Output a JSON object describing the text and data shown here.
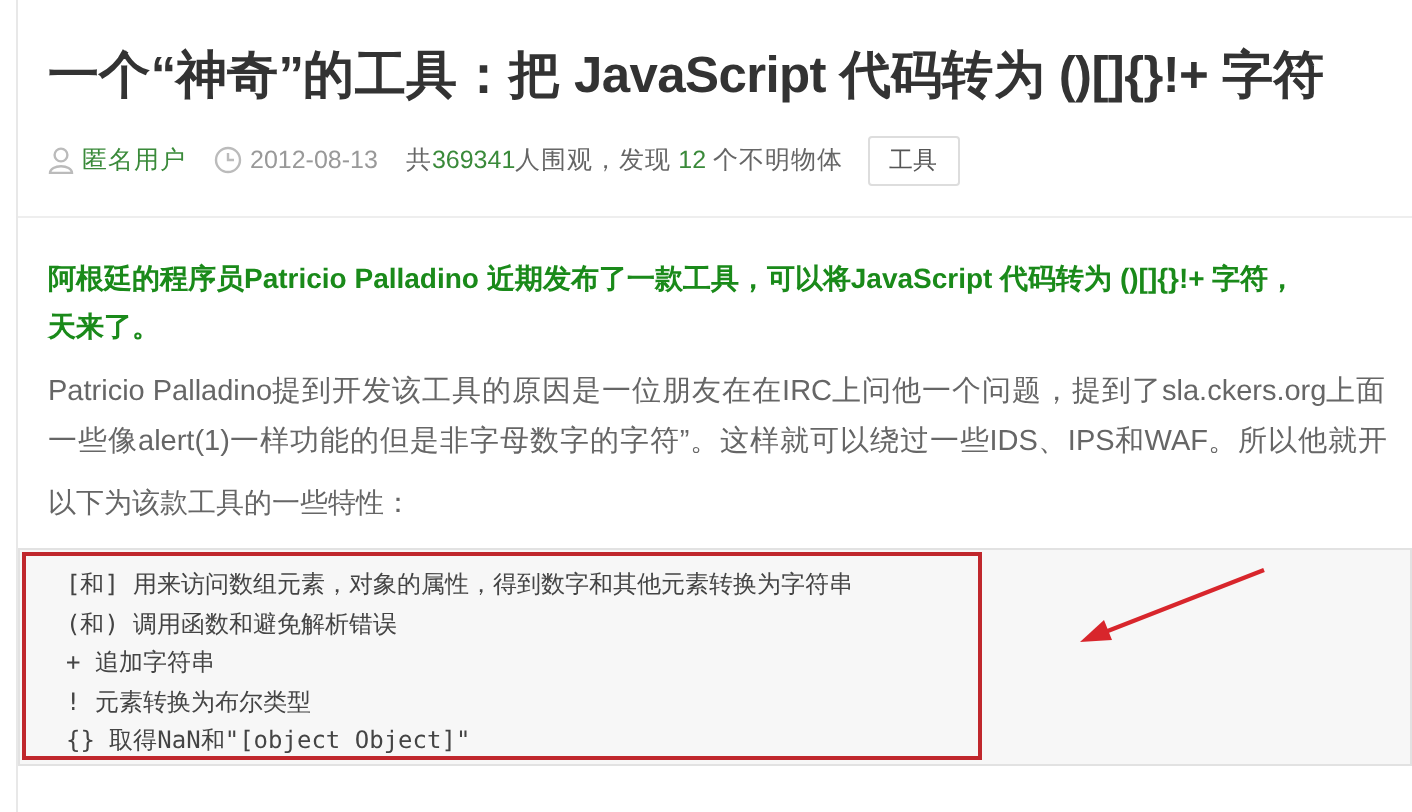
{
  "article": {
    "title": "一个“神奇”的工具：把 JavaScript 代码转为 ()[]{}!+ 字符",
    "meta": {
      "author": "匿名用户",
      "date": "2012-08-13",
      "stats": [
        {
          "text": "共",
          "highlight": false
        },
        {
          "text": "369341",
          "highlight": true
        },
        {
          "text": "人围观，发现 ",
          "highlight": false
        },
        {
          "text": "12",
          "highlight": true
        },
        {
          "text": " 个不明物体",
          "highlight": false
        }
      ],
      "tag": "工具"
    },
    "lead_lines": [
      "阿根廷的程序员Patricio Palladino 近期发布了一款工具，可以将JavaScript 代码转为 ()[]{}!+ 字符，",
      "天来了。"
    ],
    "body_lines": [
      "Patricio Palladino提到开发该工具的原因是一位朋友在在IRC上问他一个问题，提到了sla.ckers.org上面",
      "一些像alert(1)一样功能的但是非字母数字的字符”。这样就可以绕过一些IDS、IPS和WAF。所以他就开"
    ],
    "intro": "以下为该款工具的一些特性：",
    "code_lines": [
      "[和] 用来访问数组元素，对象的属性，得到数字和其他元素转换为字符串",
      "(和) 调用函数和避免解析错误",
      "+ 追加字符串",
      "! 元素转换为布尔类型",
      "{}  取得NaN和\"[object Object]\""
    ]
  }
}
